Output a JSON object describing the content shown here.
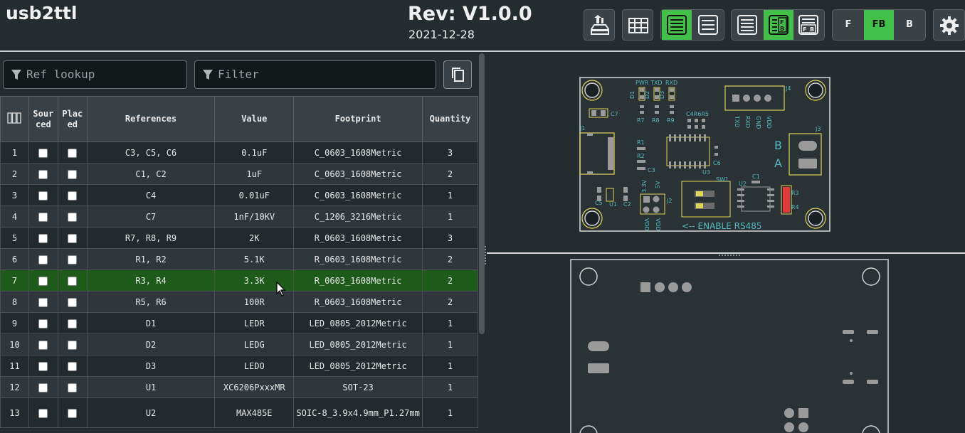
{
  "header": {
    "title": "usb2ttl",
    "revision": "Rev: V1.0.0",
    "date": "2021-12-28"
  },
  "toolbar": {
    "layer_buttons": [
      {
        "label": "F",
        "active": false
      },
      {
        "label": "FB",
        "active": true
      },
      {
        "label": "B",
        "active": false
      }
    ]
  },
  "filters": {
    "ref_lookup_placeholder": "Ref lookup",
    "filter_placeholder": "Filter"
  },
  "bom": {
    "columns": {
      "mark": "",
      "sourced": "Sour\nced",
      "placed": "Plac\ned",
      "references": "References",
      "value": "Value",
      "footprint": "Footprint",
      "quantity": "Quantity"
    },
    "rows": [
      {
        "n": "1",
        "refs": "C3, C5, C6",
        "value": "0.1uF",
        "footprint": "C_0603_1608Metric",
        "qty": "3"
      },
      {
        "n": "2",
        "refs": "C1, C2",
        "value": "1uF",
        "footprint": "C_0603_1608Metric",
        "qty": "2"
      },
      {
        "n": "3",
        "refs": "C4",
        "value": "0.01uF",
        "footprint": "C_0603_1608Metric",
        "qty": "1"
      },
      {
        "n": "4",
        "refs": "C7",
        "value": "1nF/10KV",
        "footprint": "C_1206_3216Metric",
        "qty": "1"
      },
      {
        "n": "5",
        "refs": "R7, R8, R9",
        "value": "2K",
        "footprint": "R_0603_1608Metric",
        "qty": "3"
      },
      {
        "n": "6",
        "refs": "R1, R2",
        "value": "5.1K",
        "footprint": "R_0603_1608Metric",
        "qty": "2"
      },
      {
        "n": "7",
        "refs": "R3, R4",
        "value": "3.3K",
        "footprint": "R_0603_1608Metric",
        "qty": "2"
      },
      {
        "n": "8",
        "refs": "R5, R6",
        "value": "100R",
        "footprint": "R_0603_1608Metric",
        "qty": "2"
      },
      {
        "n": "9",
        "refs": "D1",
        "value": "LEDR",
        "footprint": "LED_0805_2012Metric",
        "qty": "1"
      },
      {
        "n": "10",
        "refs": "D2",
        "value": "LEDG",
        "footprint": "LED_0805_2012Metric",
        "qty": "1"
      },
      {
        "n": "11",
        "refs": "D3",
        "value": "LEDO",
        "footprint": "LED_0805_2012Metric",
        "qty": "1"
      },
      {
        "n": "12",
        "refs": "U1",
        "value": "XC6206PxxxMR",
        "footprint": "SOT-23",
        "qty": "1"
      },
      {
        "n": "13",
        "refs": "U2",
        "value": "MAX485E",
        "footprint": "SOIC-8_3.9x4.9mm_P1.27mm",
        "qty": "1"
      }
    ],
    "highlighted_row": "7"
  },
  "pcb_front": {
    "silkscreen": {
      "leds": [
        "PWR",
        "TXD",
        "RXD"
      ],
      "d_labels": [
        "D1",
        "D2",
        "D3"
      ],
      "r_labels": [
        "R7",
        "R8",
        "R9"
      ],
      "c7": "C7",
      "j1": "J1",
      "j2": "J2",
      "j3": "J3",
      "j4": "J4",
      "r1": "R1",
      "r2": "R2",
      "c3": "C3",
      "c4r6r5": "C4R6R5",
      "u3": "U3",
      "c6": "C6",
      "sw1": "SW1",
      "c1": "C1",
      "u2": "U2",
      "r3": "R3",
      "r4": "R4",
      "c5": "C5",
      "u1": "U1",
      "c2": "C2",
      "v33": "3.3V",
      "v5": "5V",
      "vdd1": "VDD",
      "vdd2": "VDD",
      "b": "B",
      "a": "A",
      "j4_pins": [
        "TXD",
        "RXD",
        "GND",
        "VDD"
      ],
      "enable": "<-- ENABLE RS485"
    }
  },
  "colors": {
    "accent_green": "#43c04a",
    "highlight_row": "#1e5a1a",
    "silk": "#52b9c0",
    "outline": "#e0d45a",
    "pad_selected": "#e03a3a"
  }
}
